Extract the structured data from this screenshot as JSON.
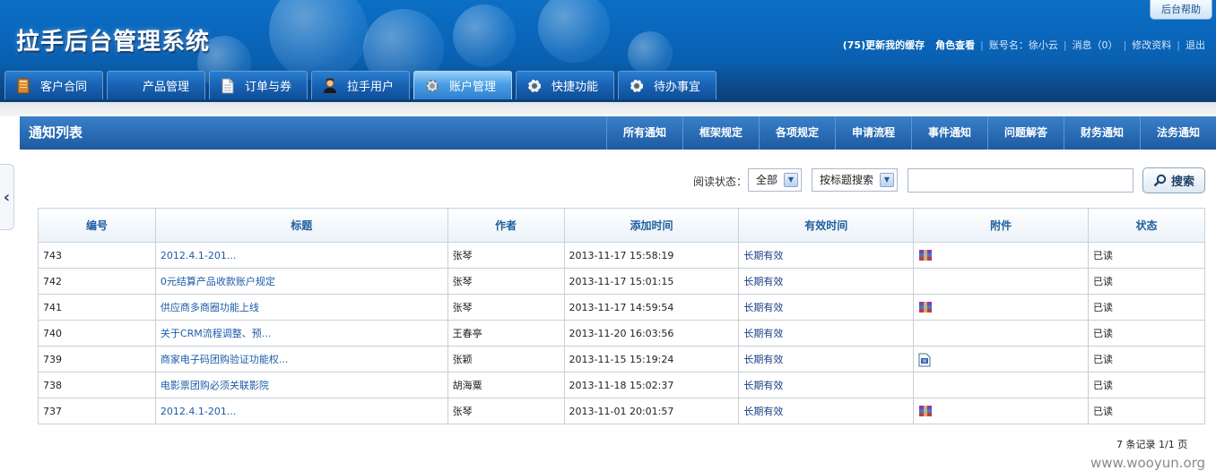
{
  "app": {
    "logo": "拉手后台管理系统",
    "help": "后台帮助"
  },
  "topbar": {
    "cache": "(75)更新我的缓存",
    "role": "角色查看",
    "account": "账号名：徐小云",
    "messages": "消息（0）",
    "edit_profile": "修改资料",
    "logout": "退出"
  },
  "nav": {
    "tabs": [
      {
        "label": "客户合同",
        "icon": "book-icon"
      },
      {
        "label": "产品管理",
        "icon": "none"
      },
      {
        "label": "订单与券",
        "icon": "document-icon"
      },
      {
        "label": "拉手用户",
        "icon": "user-icon"
      },
      {
        "label": "账户管理",
        "icon": "gear-icon",
        "active": true
      },
      {
        "label": "快捷功能",
        "icon": "gear-icon"
      },
      {
        "label": "待办事宜",
        "icon": "gear-icon"
      }
    ]
  },
  "notices": {
    "title": "通知列表",
    "categories": [
      "所有通知",
      "框架规定",
      "各项规定",
      "申请流程",
      "事件通知",
      "问题解答",
      "财务通知",
      "法务通知"
    ]
  },
  "search": {
    "read_label": "阅读状态：",
    "read_value": "全部",
    "mode_value": "按标题搜索",
    "query_value": "",
    "button": "搜索"
  },
  "table": {
    "headers": [
      "编号",
      "标题",
      "作者",
      "添加时间",
      "有效时间",
      "附件",
      "状态"
    ],
    "rows": [
      {
        "id": "743",
        "title": "2012.4.1-201...",
        "author": "张琴",
        "added": "2013-11-17 15:58:19",
        "valid": "长期有效",
        "attach": "rar",
        "status": "已读"
      },
      {
        "id": "742",
        "title": "0元结算产品收款账户规定",
        "author": "张琴",
        "added": "2013-11-17 15:01:15",
        "valid": "长期有效",
        "attach": "",
        "status": "已读"
      },
      {
        "id": "741",
        "title": "供应商多商圈功能上线",
        "author": "张琴",
        "added": "2013-11-17 14:59:54",
        "valid": "长期有效",
        "attach": "rar",
        "status": "已读"
      },
      {
        "id": "740",
        "title": "关于CRM流程调整、预...",
        "author": "王春亭",
        "added": "2013-11-20 16:03:56",
        "valid": "长期有效",
        "attach": "",
        "status": "已读"
      },
      {
        "id": "739",
        "title": "商家电子码团购验证功能权...",
        "author": "张颖",
        "added": "2013-11-15 15:19:24",
        "valid": "长期有效",
        "attach": "doc",
        "status": "已读"
      },
      {
        "id": "738",
        "title": "电影票团购必须关联影院",
        "author": "胡海粟",
        "added": "2013-11-18 15:02:37",
        "valid": "长期有效",
        "attach": "",
        "status": "已读"
      },
      {
        "id": "737",
        "title": "2012.4.1-201...",
        "author": "张琴",
        "added": "2013-11-01 20:01:57",
        "valid": "长期有效",
        "attach": "rar",
        "status": "已读"
      }
    ]
  },
  "footer": "7 条记录 1/1 页",
  "watermark": "www.wooyun.org"
}
